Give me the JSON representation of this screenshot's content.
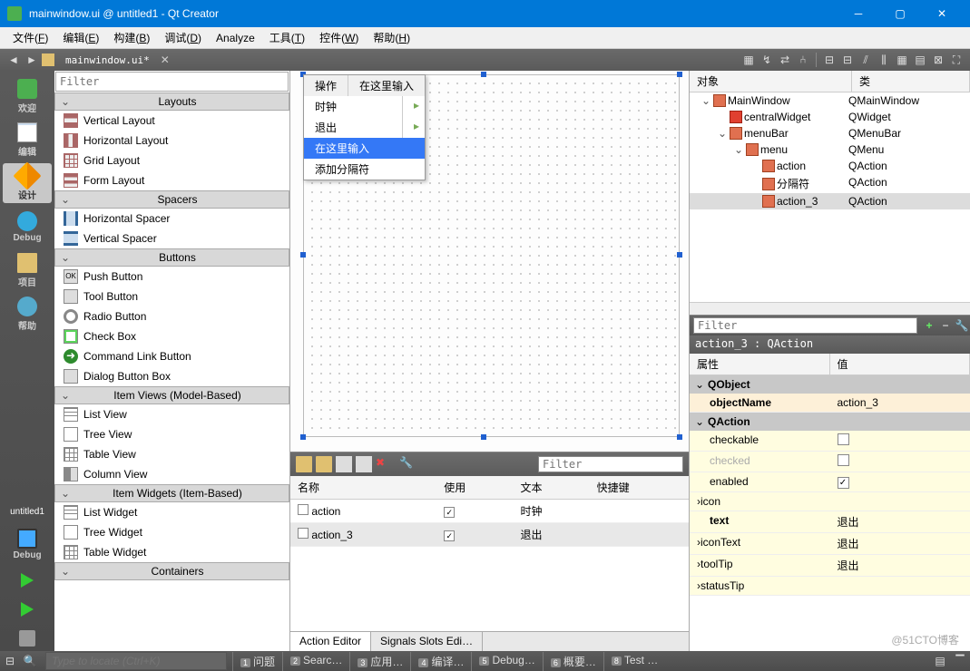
{
  "title": "mainwindow.ui @ untitled1 - Qt Creator",
  "menubar": [
    "文件(F)",
    "编辑(E)",
    "构建(B)",
    "调试(D)",
    "Analyze",
    "工具(T)",
    "控件(W)",
    "帮助(H)"
  ],
  "breadcrumb": "mainwindow.ui*",
  "modebar": [
    {
      "k": "welcome",
      "label": "欢迎"
    },
    {
      "k": "edit",
      "label": "编辑"
    },
    {
      "k": "design",
      "label": "设计",
      "active": true
    },
    {
      "k": "debug",
      "label": "Debug"
    },
    {
      "k": "projects",
      "label": "项目"
    },
    {
      "k": "help",
      "label": "帮助"
    }
  ],
  "project_name": "untitled1",
  "debug_label": "Debug",
  "wbox": {
    "filter_ph": "Filter",
    "cats": [
      {
        "name": "Layouts",
        "items": [
          {
            "icon": "ic-vbox",
            "label": "Vertical Layout"
          },
          {
            "icon": "ic-hbox",
            "label": "Horizontal Layout"
          },
          {
            "icon": "ic-grid",
            "label": "Grid Layout"
          },
          {
            "icon": "ic-form",
            "label": "Form Layout"
          }
        ]
      },
      {
        "name": "Spacers",
        "items": [
          {
            "icon": "ic-hspacer",
            "label": "Horizontal Spacer"
          },
          {
            "icon": "ic-vspacer",
            "label": "Vertical Spacer"
          }
        ]
      },
      {
        "name": "Buttons",
        "items": [
          {
            "icon": "ic-ok",
            "label": "Push Button"
          },
          {
            "icon": "ic-tool",
            "label": "Tool Button"
          },
          {
            "icon": "ic-radio",
            "label": "Radio Button"
          },
          {
            "icon": "ic-check",
            "label": "Check Box"
          },
          {
            "icon": "ic-link",
            "label": "Command Link Button"
          },
          {
            "icon": "ic-dlg",
            "label": "Dialog Button Box"
          }
        ]
      },
      {
        "name": "Item Views (Model-Based)",
        "items": [
          {
            "icon": "ic-list",
            "label": "List View"
          },
          {
            "icon": "ic-tree",
            "label": "Tree View"
          },
          {
            "icon": "ic-table",
            "label": "Table View"
          },
          {
            "icon": "ic-col",
            "label": "Column View"
          }
        ]
      },
      {
        "name": "Item Widgets (Item-Based)",
        "items": [
          {
            "icon": "ic-list",
            "label": "List Widget"
          },
          {
            "icon": "ic-tree",
            "label": "Tree Widget"
          },
          {
            "icon": "ic-table",
            "label": "Table Widget"
          }
        ]
      },
      {
        "name": "Containers",
        "items": []
      }
    ]
  },
  "dropdown": {
    "header": [
      "操作",
      "在这里输入"
    ],
    "rows": [
      {
        "label": "时钟",
        "sub": true
      },
      {
        "label": "退出",
        "sub": true
      }
    ],
    "sel": "在这里输入",
    "add": "添加分隔符"
  },
  "action_editor": {
    "filter_ph": "Filter",
    "cols": [
      "名称",
      "使用",
      "文本",
      "快捷键"
    ],
    "rows": [
      {
        "name": "action",
        "use": true,
        "text": "时钟"
      },
      {
        "name": "action_3",
        "use": true,
        "text": "退出",
        "sel": true
      }
    ],
    "tabs": [
      "Action Editor",
      "Signals Slots Edi…"
    ]
  },
  "obj": {
    "cols": [
      "对象",
      "类"
    ],
    "tree": [
      {
        "d": 0,
        "tw": "v",
        "name": "MainWindow",
        "cls": "QMainWindow"
      },
      {
        "d": 1,
        "tw": "",
        "icon": "ic-red",
        "name": "centralWidget",
        "cls": "QWidget"
      },
      {
        "d": 1,
        "tw": "v",
        "name": "menuBar",
        "cls": "QMenuBar"
      },
      {
        "d": 2,
        "tw": "v",
        "name": "menu",
        "cls": "QMenu"
      },
      {
        "d": 3,
        "tw": "",
        "name": "action",
        "cls": "QAction"
      },
      {
        "d": 3,
        "tw": "",
        "name": "分隔符",
        "cls": "QAction"
      },
      {
        "d": 3,
        "tw": "",
        "name": "action_3",
        "cls": "QAction",
        "sel": true
      }
    ]
  },
  "prop": {
    "filter_ph": "Filter",
    "objline": "action_3 : QAction",
    "cols": [
      "属性",
      "值"
    ],
    "groups": [
      {
        "name": "QObject",
        "rows": [
          {
            "n": "objectName",
            "v": "action_3",
            "cls": "tan",
            "bold": true
          }
        ]
      },
      {
        "name": "QAction",
        "rows": [
          {
            "n": "checkable",
            "v": "",
            "cls": "yel",
            "chk": false
          },
          {
            "n": "checked",
            "v": "",
            "cls": "yel",
            "chk": false,
            "dim": true
          },
          {
            "n": "enabled",
            "v": "",
            "cls": "yel",
            "chk": true
          },
          {
            "n": "icon",
            "v": "",
            "cls": "yel",
            "exp": true
          },
          {
            "n": "text",
            "v": "退出",
            "cls": "yel",
            "bold": true
          },
          {
            "n": "iconText",
            "v": "退出",
            "cls": "yel",
            "exp": true
          },
          {
            "n": "toolTip",
            "v": "退出",
            "cls": "yel",
            "exp": true
          },
          {
            "n": "statusTip",
            "v": "",
            "cls": "yel",
            "exp": true
          }
        ]
      }
    ]
  },
  "status": {
    "placeholder": "Type to locate (Ctrl+K)",
    "tabs": [
      {
        "n": "1",
        "t": "问题"
      },
      {
        "n": "2",
        "t": "Searc…"
      },
      {
        "n": "3",
        "t": "应用…"
      },
      {
        "n": "4",
        "t": "编译…"
      },
      {
        "n": "5",
        "t": "Debug…"
      },
      {
        "n": "6",
        "t": "概要…"
      },
      {
        "n": "8",
        "t": "Test …"
      }
    ]
  },
  "watermark": "@51CTO博客"
}
